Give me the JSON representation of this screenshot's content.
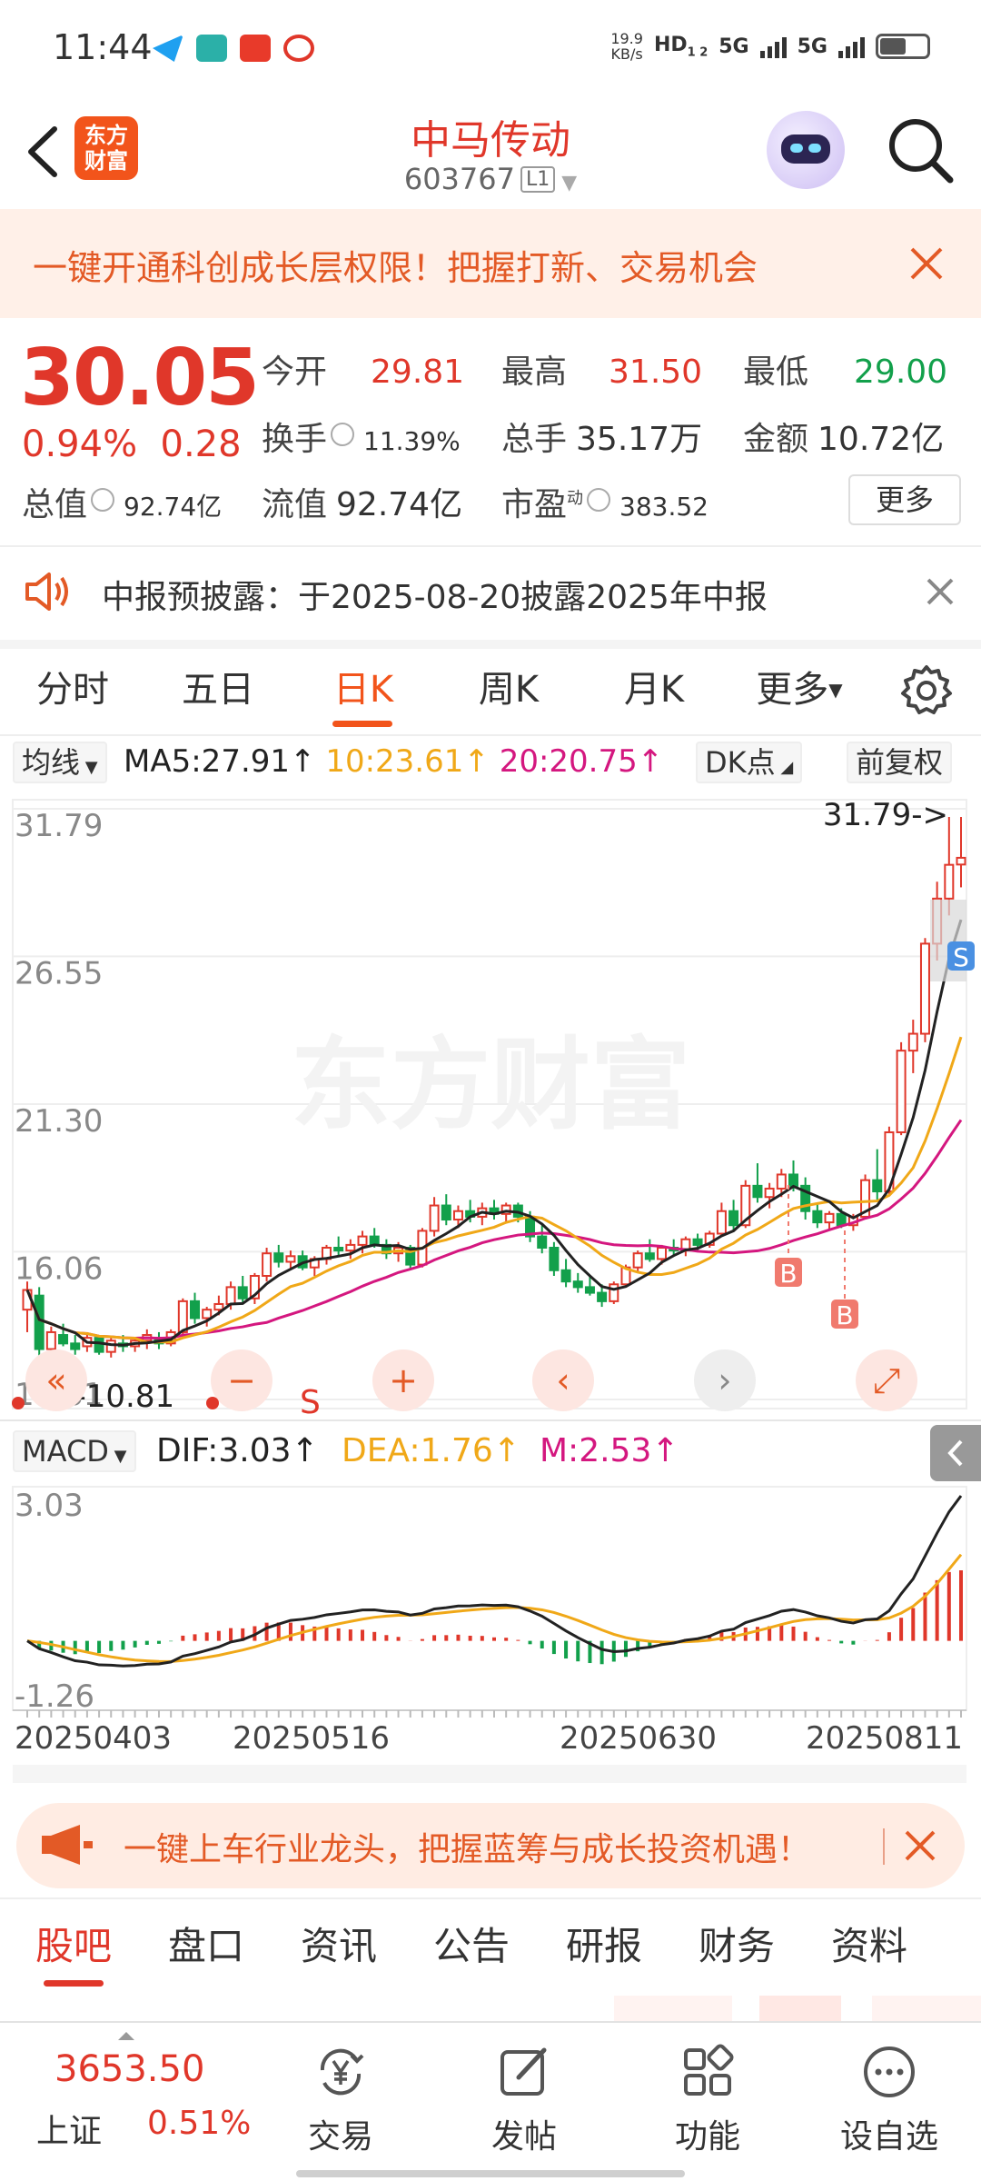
{
  "status_bar": {
    "time": "11:44",
    "net_speed_value": "19.9",
    "net_speed_unit": "KB/s",
    "tags": [
      "HD",
      "5G",
      "5G"
    ],
    "hd_sub": "1 2"
  },
  "header": {
    "logo_text_top": "东方",
    "logo_text_bottom": "财富",
    "stock_name": "中马传动",
    "stock_code": "603767",
    "level_badge": "L1"
  },
  "promo": {
    "text": "一键开通科创成长层权限！把握打新、交易机会"
  },
  "quote": {
    "price": "30.05",
    "change_pct": "0.94%",
    "change_amt": "0.28",
    "open_label": "今开",
    "open": "29.81",
    "high_label": "最高",
    "high": "31.50",
    "low_label": "最低",
    "low": "29.00",
    "turnover_label": "换手",
    "turnover": "11.39%",
    "volume_label": "总手",
    "volume": "35.17万",
    "amount_label": "金额",
    "amount": "10.72亿",
    "mktcap_label": "总值",
    "mktcap": "92.74亿",
    "float_label": "流值",
    "float_cap": "92.74亿",
    "pe_label": "市盈",
    "pe_sup": "动",
    "pe": "383.52",
    "more_button": "更多"
  },
  "notice": {
    "text": "中报预披露：于2025-08-20披露2025年中报"
  },
  "chart_tabs": [
    "分时",
    "五日",
    "日K",
    "周K",
    "月K",
    "更多"
  ],
  "chart_tabs_active": "日K",
  "indicator": {
    "ma_select": "均线",
    "ma5": "MA5:27.91↑",
    "ma10": "10:23.61↑",
    "ma20": "20:20.75↑",
    "dk_button": "DK点",
    "adjust_button": "前复权",
    "ma5_color": "#222222",
    "ma10_color": "#f0a818",
    "ma20_color": "#d4177f"
  },
  "kline_labels": {
    "y_top": "31.79",
    "y2": "26.55",
    "y3": "21.30",
    "y4": "16.06",
    "y_bottom": "10.81",
    "max_marker": "31.79->",
    "min_marker": "<-10.81",
    "watermark": "东方财富",
    "buy_marker": "B",
    "sell_marker": "S",
    "s_marker_left": "S"
  },
  "macd": {
    "select": "MACD",
    "dif": "DIF:3.03↑",
    "dea": "DEA:1.76↑",
    "m": "M:2.53↑",
    "y_top": "3.03",
    "y_bottom": "-1.26"
  },
  "x_axis_dates": [
    "20250403",
    "20250516",
    "20250630",
    "20250811"
  ],
  "banner2": {
    "text": "一键上车行业龙头，把握蓝筹与成长投资机遇！"
  },
  "bottom_tabs": [
    "股吧",
    "盘口",
    "资讯",
    "公告",
    "研报",
    "财务",
    "资料"
  ],
  "bottom_tabs_active": "股吧",
  "bottom_bar": {
    "index_name": "上证",
    "index_value": "3653.50",
    "index_pct": "0.51%",
    "items": [
      {
        "label": "交易",
        "icon": "yen-exchange-icon"
      },
      {
        "label": "发帖",
        "icon": "edit-post-icon"
      },
      {
        "label": "功能",
        "icon": "grid-apps-icon"
      },
      {
        "label": "设自选",
        "icon": "more-dots-icon"
      }
    ]
  },
  "chart_data": {
    "type": "candlestick",
    "ylim": [
      10.81,
      31.79
    ],
    "x_ticks": [
      "20250403",
      "20250516",
      "20250630",
      "20250811"
    ],
    "ohlc_approx": [
      [
        14.0,
        15.0,
        13.2,
        14.7
      ],
      [
        14.5,
        14.8,
        12.3,
        12.6
      ],
      [
        12.6,
        13.4,
        11.8,
        13.2
      ],
      [
        13.1,
        13.5,
        12.7,
        12.8
      ],
      [
        12.8,
        13.1,
        12.4,
        12.6
      ],
      [
        12.7,
        13.2,
        12.5,
        13.0
      ],
      [
        13.0,
        13.1,
        12.4,
        12.5
      ],
      [
        12.5,
        13.0,
        12.3,
        12.9
      ],
      [
        12.8,
        13.1,
        12.5,
        12.7
      ],
      [
        12.7,
        13.0,
        12.5,
        12.9
      ],
      [
        12.9,
        13.3,
        12.6,
        13.1
      ],
      [
        13.0,
        13.2,
        12.6,
        12.8
      ],
      [
        12.8,
        13.3,
        12.7,
        13.2
      ],
      [
        13.2,
        14.4,
        13.1,
        14.3
      ],
      [
        14.3,
        14.6,
        13.5,
        13.7
      ],
      [
        13.7,
        14.1,
        13.4,
        14.0
      ],
      [
        14.0,
        14.5,
        13.8,
        14.2
      ],
      [
        14.2,
        15.0,
        14.0,
        14.8
      ],
      [
        14.8,
        15.2,
        14.2,
        14.4
      ],
      [
        14.4,
        15.3,
        14.2,
        15.2
      ],
      [
        15.2,
        16.2,
        15.0,
        16.0
      ],
      [
        16.0,
        16.3,
        15.5,
        15.7
      ],
      [
        15.7,
        16.1,
        15.4,
        15.9
      ],
      [
        15.9,
        16.1,
        15.4,
        15.5
      ],
      [
        15.5,
        15.9,
        15.2,
        15.8
      ],
      [
        15.8,
        16.3,
        15.6,
        16.2
      ],
      [
        16.2,
        16.6,
        15.9,
        16.1
      ],
      [
        16.1,
        16.5,
        15.8,
        16.3
      ],
      [
        16.3,
        16.8,
        16.0,
        16.6
      ],
      [
        16.6,
        16.9,
        16.2,
        16.3
      ],
      [
        16.3,
        16.5,
        15.8,
        16.0
      ],
      [
        16.0,
        16.4,
        15.7,
        16.2
      ],
      [
        16.2,
        16.3,
        15.4,
        15.6
      ],
      [
        15.6,
        16.9,
        15.5,
        16.8
      ],
      [
        16.8,
        18.0,
        16.6,
        17.7
      ],
      [
        17.7,
        18.1,
        17.0,
        17.2
      ],
      [
        17.2,
        17.7,
        16.9,
        17.5
      ],
      [
        17.5,
        17.9,
        17.1,
        17.3
      ],
      [
        17.3,
        17.8,
        17.0,
        17.6
      ],
      [
        17.6,
        17.9,
        17.2,
        17.4
      ],
      [
        17.4,
        17.8,
        17.1,
        17.7
      ],
      [
        17.7,
        17.8,
        17.1,
        17.3
      ],
      [
        17.3,
        17.5,
        16.4,
        16.6
      ],
      [
        16.6,
        17.0,
        16.0,
        16.2
      ],
      [
        16.2,
        16.4,
        15.2,
        15.4
      ],
      [
        15.4,
        15.8,
        14.8,
        15.0
      ],
      [
        15.0,
        15.3,
        14.6,
        14.8
      ],
      [
        14.8,
        15.2,
        14.5,
        14.6
      ],
      [
        14.6,
        14.9,
        14.1,
        14.3
      ],
      [
        14.3,
        15.0,
        14.2,
        14.9
      ],
      [
        14.9,
        15.6,
        14.8,
        15.5
      ],
      [
        15.5,
        16.1,
        15.3,
        16.0
      ],
      [
        16.0,
        16.5,
        15.7,
        15.8
      ],
      [
        15.8,
        16.3,
        15.6,
        16.2
      ],
      [
        16.2,
        16.5,
        15.9,
        16.1
      ],
      [
        16.1,
        16.6,
        15.9,
        16.5
      ],
      [
        16.5,
        16.7,
        16.1,
        16.3
      ],
      [
        16.3,
        16.8,
        16.2,
        16.7
      ],
      [
        16.7,
        17.8,
        16.6,
        17.5
      ],
      [
        17.5,
        17.9,
        16.8,
        17.0
      ],
      [
        17.0,
        18.6,
        16.9,
        18.4
      ],
      [
        18.4,
        19.2,
        17.8,
        18.0
      ],
      [
        18.0,
        18.5,
        17.6,
        18.3
      ],
      [
        18.3,
        19.0,
        18.0,
        18.8
      ],
      [
        18.8,
        19.3,
        18.2,
        18.4
      ],
      [
        18.4,
        18.7,
        17.2,
        17.5
      ],
      [
        17.5,
        17.8,
        16.9,
        17.1
      ],
      [
        17.1,
        17.5,
        16.8,
        17.4
      ],
      [
        17.4,
        17.6,
        16.9,
        17.0
      ],
      [
        17.0,
        17.4,
        16.8,
        17.3
      ],
      [
        17.3,
        18.8,
        17.2,
        18.6
      ],
      [
        18.6,
        19.7,
        17.9,
        18.2
      ],
      [
        18.2,
        20.5,
        18.1,
        20.3
      ],
      [
        20.3,
        23.5,
        20.2,
        23.2
      ],
      [
        23.2,
        24.3,
        22.4,
        23.8
      ],
      [
        23.8,
        27.2,
        23.5,
        27.0
      ],
      [
        27.0,
        29.2,
        26.4,
        28.6
      ],
      [
        28.6,
        31.5,
        28.0,
        29.8
      ],
      [
        29.81,
        31.5,
        29.0,
        30.05
      ]
    ],
    "ma5_last": 27.91,
    "ma10_last": 23.61,
    "ma20_last": 20.75,
    "macd": {
      "dif_last": 3.03,
      "dea_last": 1.76,
      "m_last": 2.53,
      "ylim": [
        -1.26,
        3.03
      ]
    }
  }
}
